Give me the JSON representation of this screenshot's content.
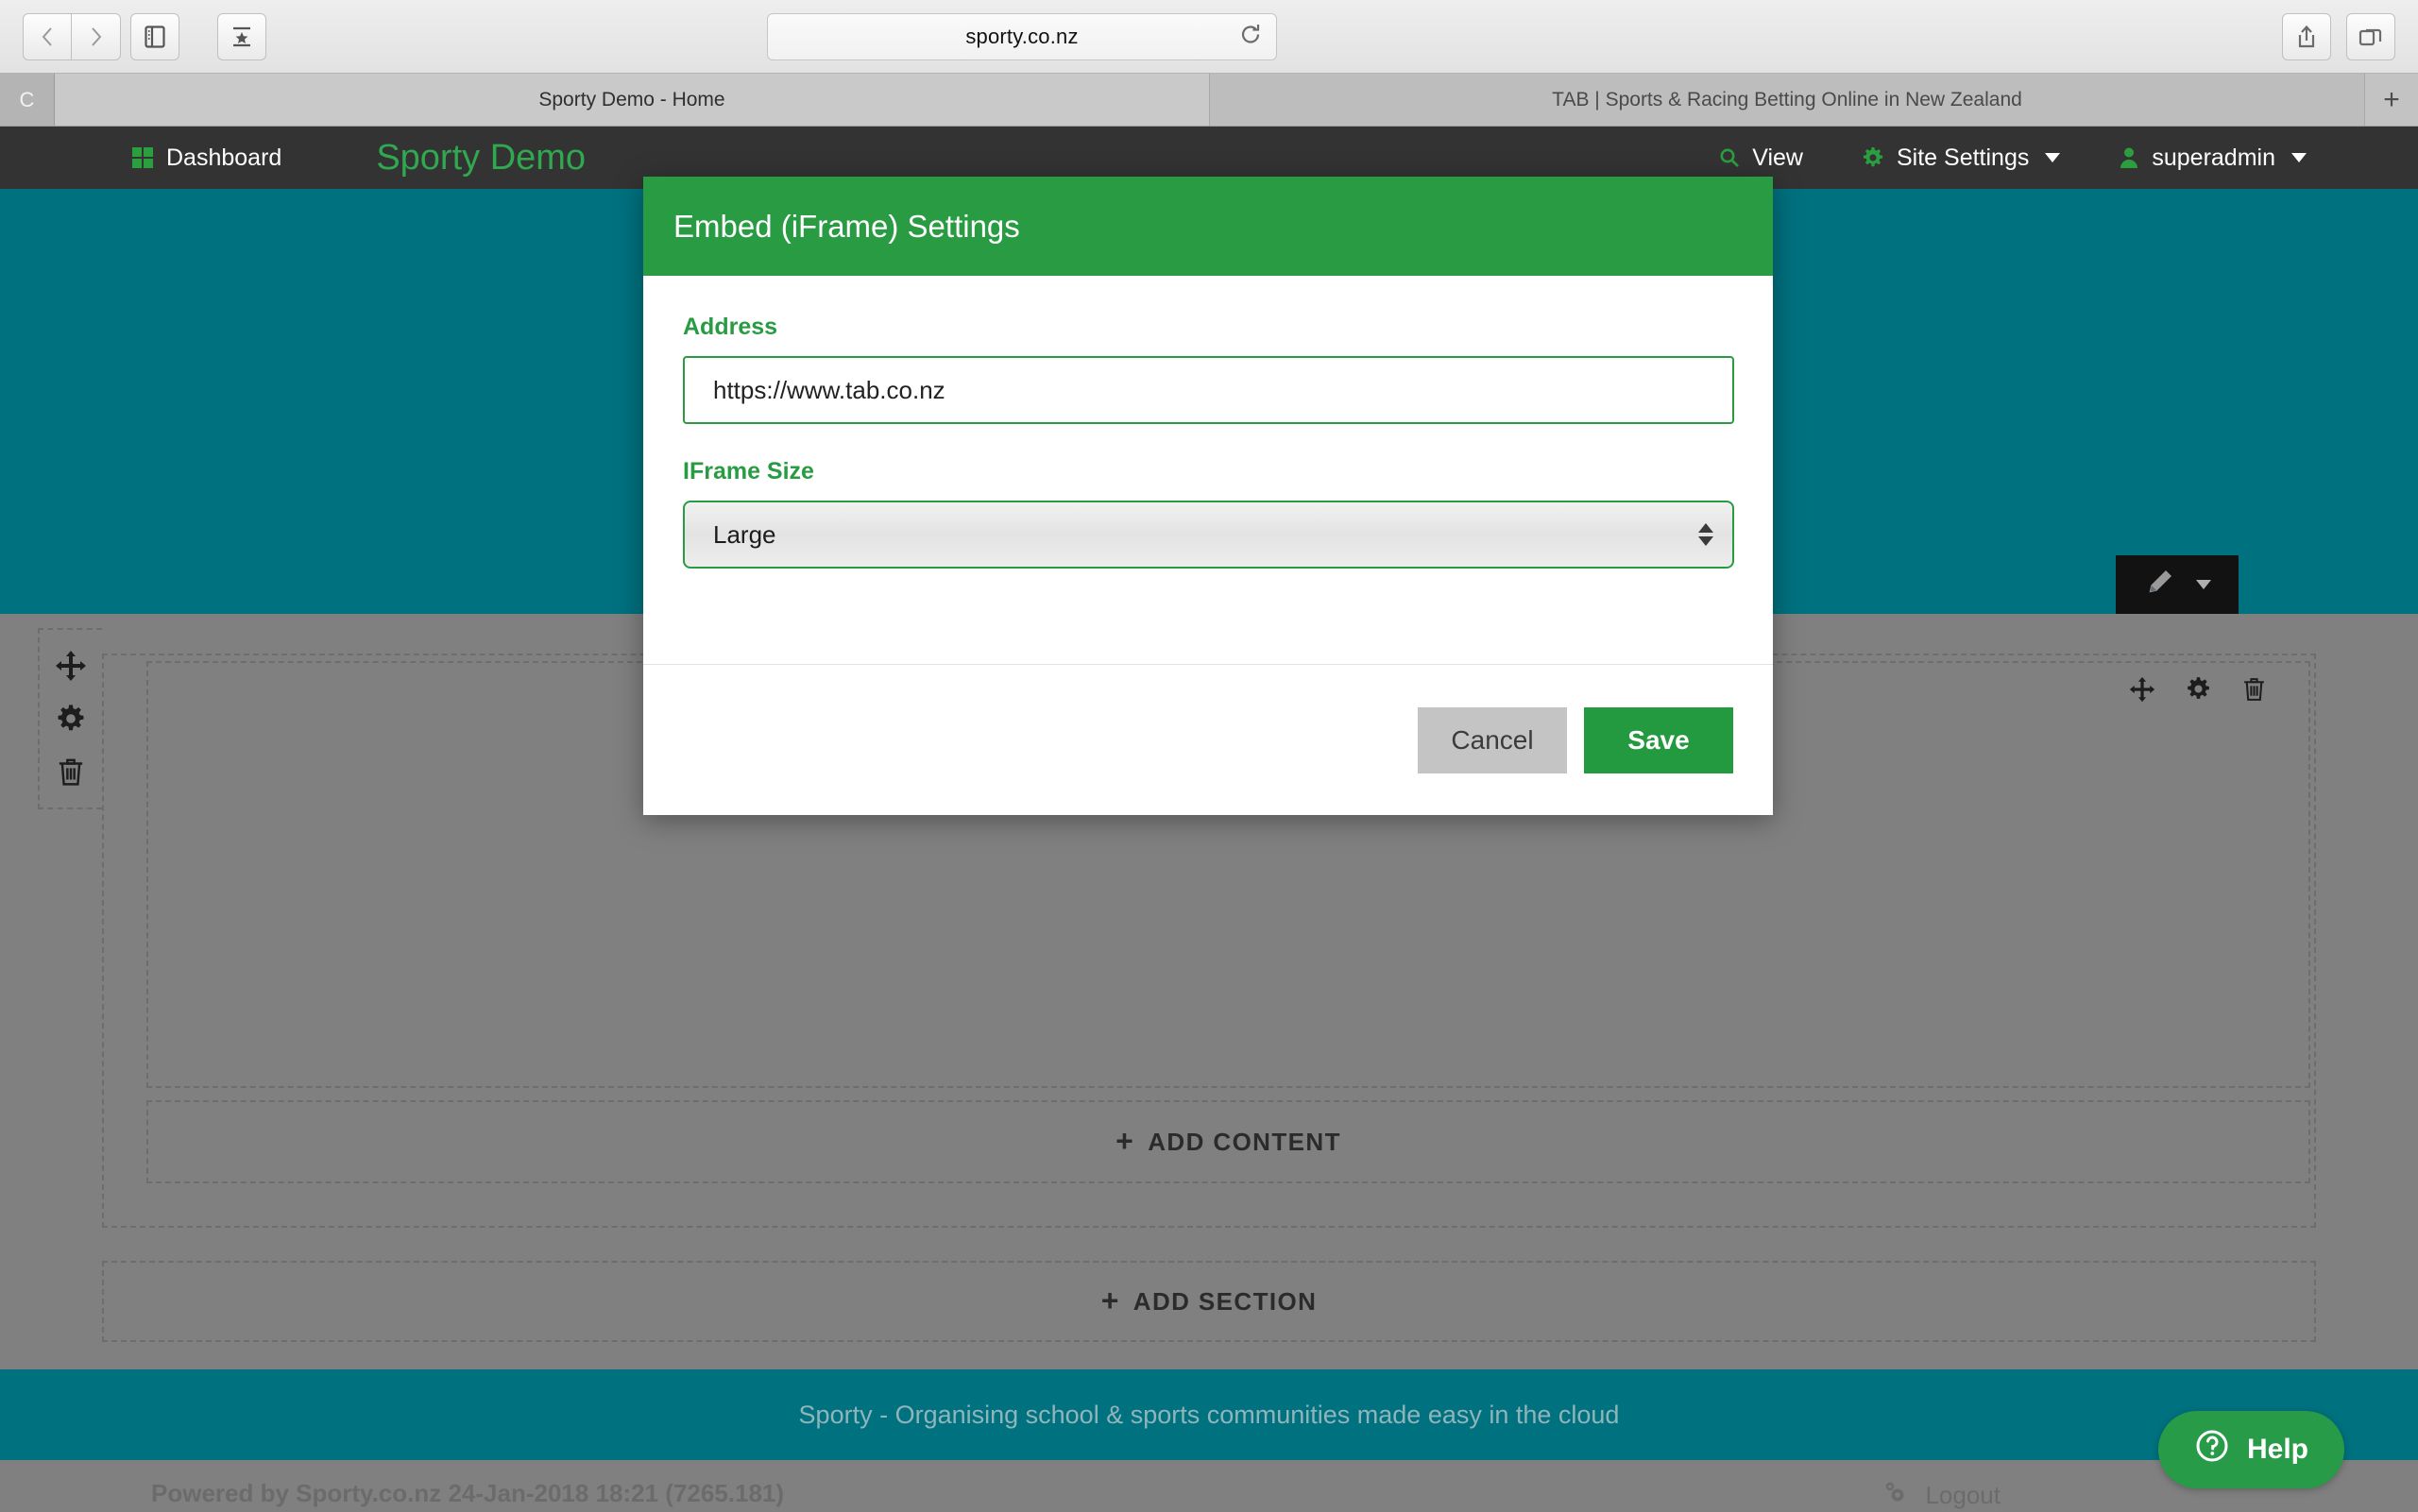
{
  "browser": {
    "url": "sporty.co.nz",
    "back_icon": "chevron-left-icon",
    "forward_icon": "chevron-right-icon",
    "sidebar_icon": "sidebar-toggle-icon",
    "bookmarks_icon": "bookmarks-star-icon",
    "reload_icon": "reload-icon",
    "share_icon": "share-icon",
    "tabs_overview_icon": "tab-overview-icon",
    "tabs": [
      {
        "label": "Sporty Demo - Home",
        "active": true
      },
      {
        "label": "TAB | Sports & Racing Betting Online in New Zealand",
        "active": false
      }
    ],
    "tab_badge": "C",
    "new_tab_label": "+"
  },
  "app_nav": {
    "dashboard_label": "Dashboard",
    "dashboard_icon": "grid-icon",
    "site_title": "Sporty Demo",
    "view_label": "View",
    "view_icon": "search-icon",
    "site_settings_label": "Site Settings",
    "site_settings_icon": "gear-icon",
    "user_label": "superadmin",
    "user_icon": "person-icon",
    "caret_icon": "chevron-down-icon"
  },
  "editor": {
    "edit_pencil_icon": "pencil-icon",
    "edit_caret_icon": "chevron-down-icon",
    "move_icon": "move-arrows-icon",
    "settings_icon": "gear-icon",
    "delete_icon": "trash-icon",
    "add_content_label": "ADD CONTENT",
    "add_section_label": "ADD SECTION",
    "plus_glyph": "+"
  },
  "modal": {
    "title": "Embed (iFrame) Settings",
    "address_label": "Address",
    "address_value": "https://www.tab.co.nz",
    "address_placeholder": "https://",
    "iframe_size_label": "IFrame Size",
    "iframe_size_value": "Large",
    "iframe_size_options": [
      "Large"
    ],
    "cancel_label": "Cancel",
    "save_label": "Save"
  },
  "footer": {
    "tagline": "Sporty - Organising school & sports communities made easy in the cloud",
    "powered_by": "Powered by Sporty.co.nz 24-Jan-2018 18:21 (7265.181)",
    "logout_label": "Logout",
    "logout_icon": "gears-icon",
    "help_label": "Help",
    "help_icon": "question-circle-icon"
  },
  "colors": {
    "brand_green": "#289B43",
    "teal": "#00717f",
    "navbar_dark": "#333333",
    "body_grey": "#808080"
  }
}
